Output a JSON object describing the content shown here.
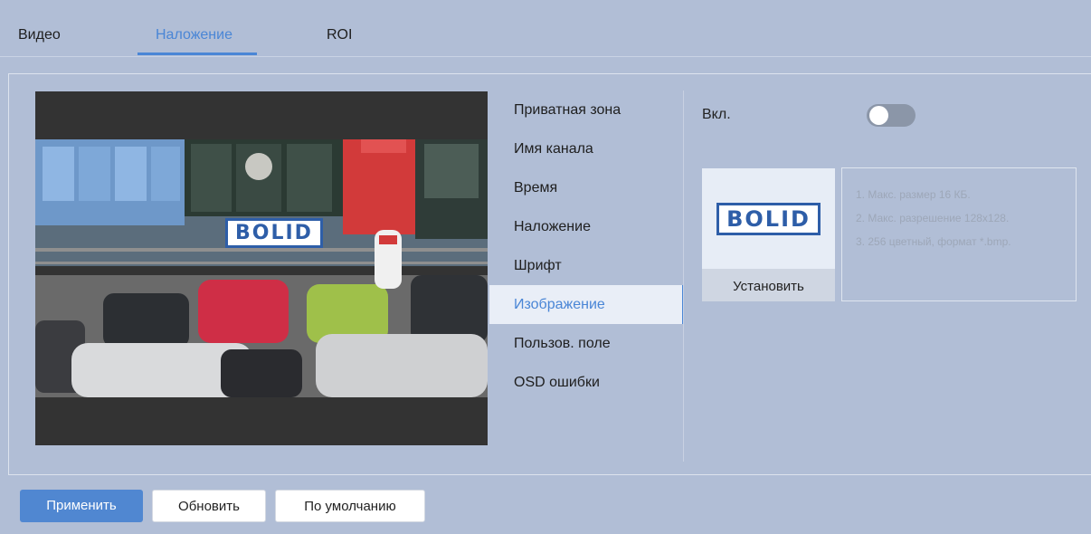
{
  "tabs": [
    {
      "label": "Видео",
      "active": false
    },
    {
      "label": "Наложение",
      "active": true
    },
    {
      "label": "ROI",
      "active": false
    }
  ],
  "preview": {
    "logo_text": "BOLID"
  },
  "menu": {
    "items": [
      {
        "label": "Приватная зона",
        "active": false
      },
      {
        "label": "Имя канала",
        "active": false
      },
      {
        "label": "Время",
        "active": false
      },
      {
        "label": "Наложение",
        "active": false
      },
      {
        "label": "Шрифт",
        "active": false
      },
      {
        "label": "Изображение",
        "active": true
      },
      {
        "label": "Пользов. поле",
        "active": false
      },
      {
        "label": "OSD ошибки",
        "active": false
      }
    ]
  },
  "settings": {
    "enable_label": "Вкл.",
    "enabled": false,
    "logo_text": "BOLID",
    "install_label": "Установить",
    "info": [
      "1. Макс. размер 16 КБ.",
      "2. Макс. разрешение 128x128.",
      "3. 256 цветный, формат *.bmp."
    ]
  },
  "footer": {
    "apply_label": "Применить",
    "refresh_label": "Обновить",
    "default_label": "По умолчанию"
  },
  "colors": {
    "background": "#b1bed6",
    "accent": "#4a86d6",
    "primary_button": "#5087d1",
    "logo_blue": "#2e5ea8"
  }
}
